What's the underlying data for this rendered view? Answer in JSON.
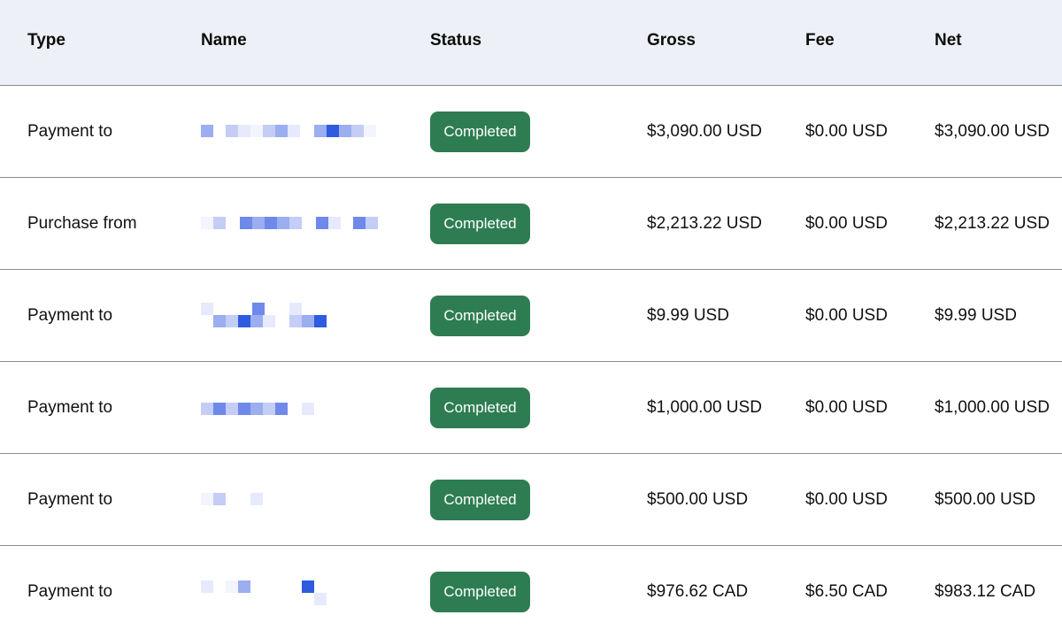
{
  "header": {
    "type": "Type",
    "name": "Name",
    "status": "Status",
    "gross": "Gross",
    "fee": "Fee",
    "net": "Net"
  },
  "rows": [
    {
      "type": "Payment to",
      "status": "Completed",
      "gross": "$3,090.00 USD",
      "fee": "$0.00 USD",
      "net": "$3,090.00 USD"
    },
    {
      "type": "Purchase from",
      "status": "Completed",
      "gross": "$2,213.22 USD",
      "fee": "$0.00 USD",
      "net": "$2,213.22 USD"
    },
    {
      "type": "Payment to",
      "status": "Completed",
      "gross": "$9.99 USD",
      "fee": "$0.00 USD",
      "net": "$9.99 USD"
    },
    {
      "type": "Payment to",
      "status": "Completed",
      "gross": "$1,000.00 USD",
      "fee": "$0.00 USD",
      "net": "$1,000.00 USD"
    },
    {
      "type": "Payment to",
      "status": "Completed",
      "gross": "$500.00 USD",
      "fee": "$0.00 USD",
      "net": "$500.00 USD"
    },
    {
      "type": "Payment to",
      "status": "Completed",
      "gross": "$976.62 CAD",
      "fee": "$6.50 CAD",
      "net": "$983.12 CAD"
    }
  ],
  "colors": {
    "header_bg": "#edf0f6",
    "badge_bg": "#2e7d52",
    "badge_text": "#ffffff",
    "divider": "#8c8c8c",
    "redaction_blue": "#2f5be0"
  }
}
